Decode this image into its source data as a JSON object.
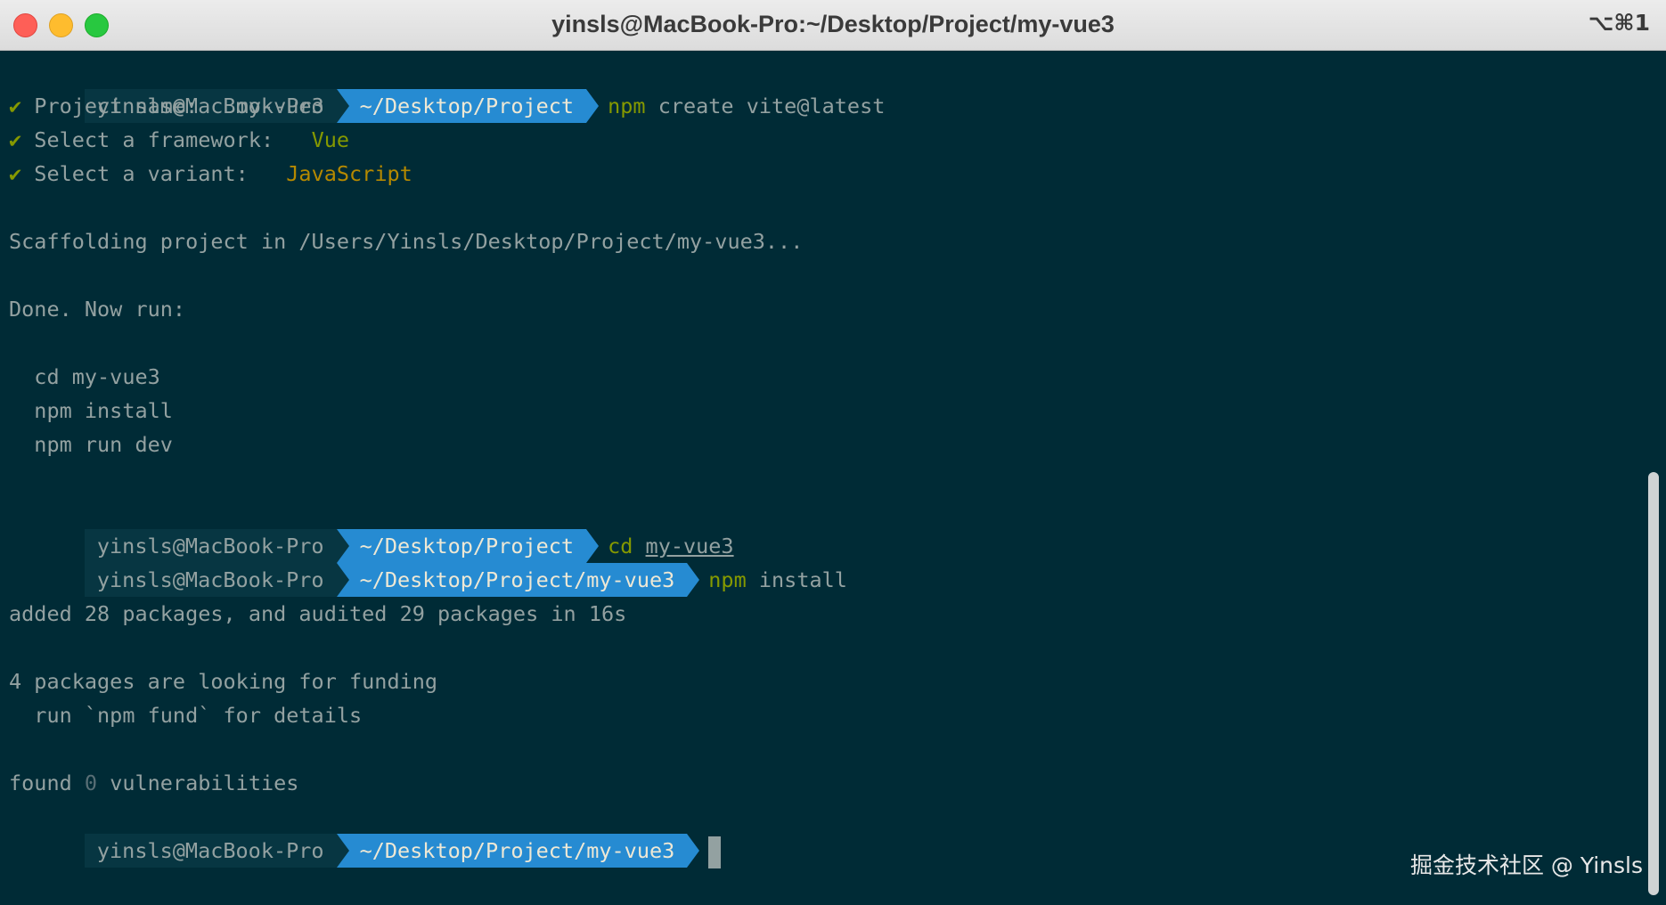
{
  "window": {
    "title": "yinsls@MacBook-Pro:~/Desktop/Project/my-vue3",
    "shortcut": "⌥⌘1"
  },
  "terminal": {
    "prompt1": {
      "user": "yinsls@MacBook-Pro",
      "path": "~/Desktop/Project",
      "cmd": "npm",
      "args": " create vite@latest"
    },
    "check_mark": "✔",
    "q1": {
      "label": " Project name:   ",
      "answer": "my-vue3"
    },
    "q2": {
      "label": " Select a framework:   ",
      "answer": "Vue"
    },
    "q3": {
      "label": " Select a variant:   ",
      "answer": "JavaScript"
    },
    "scaffolding": "Scaffolding project in /Users/Yinsls/Desktop/Project/my-vue3...",
    "done": "Done. Now run:",
    "step1": "  cd my-vue3",
    "step2": "  npm install",
    "step3": "  npm run dev",
    "prompt2": {
      "user": "yinsls@MacBook-Pro",
      "path": "~/Desktop/Project",
      "cmd": "cd",
      "arg": "my-vue3"
    },
    "prompt3": {
      "user": "yinsls@MacBook-Pro",
      "path": "~/Desktop/Project/my-vue3",
      "cmd": "npm",
      "args": " install"
    },
    "added": "added 28 packages, and audited 29 packages in 16s",
    "funding1": "4 packages are looking for funding",
    "funding2": "  run `npm fund` for details",
    "found_pre": "found ",
    "found_num": "0",
    "found_post": " vulnerabilities",
    "prompt4": {
      "user": "yinsls@MacBook-Pro",
      "path": "~/Desktop/Project/my-vue3"
    }
  },
  "watermark": "掘金技术社区 @ Yinsls",
  "colors": {
    "background": "#002b36",
    "prompt_user_bg": "#073642",
    "prompt_path_bg": "#268bd2",
    "command_green": "#859900",
    "answer_yellow": "#b58900"
  }
}
